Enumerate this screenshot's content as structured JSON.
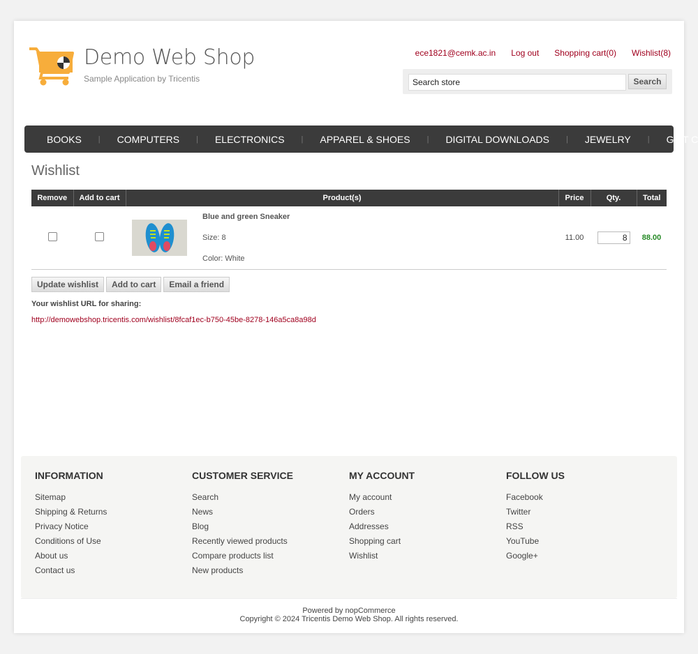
{
  "logo": {
    "title": "Demo Web Shop",
    "subtitle": "Sample Application by Tricentis"
  },
  "header_links": [
    "ece1821@cemk.ac.in",
    "Log out",
    "Shopping cart(0)",
    "Wishlist(8)"
  ],
  "search": {
    "value": "Search store",
    "button": "Search"
  },
  "menu": [
    "BOOKS",
    "COMPUTERS",
    "ELECTRONICS",
    "APPAREL & SHOES",
    "DIGITAL DOWNLOADS",
    "JEWELRY",
    "GIFT CARDS"
  ],
  "page_title": "Wishlist",
  "table": {
    "headers": [
      "Remove",
      "Add to cart",
      "Product(s)",
      "Price",
      "Qty.",
      "Total"
    ],
    "rows": [
      {
        "name": "Blue and green Sneaker",
        "size": "Size: 8",
        "color": "Color: White",
        "price": "11.00",
        "qty": "8",
        "total": "88.00"
      }
    ]
  },
  "buttons": [
    "Update wishlist",
    "Add to cart",
    "Email a friend"
  ],
  "share": {
    "label": "Your wishlist URL for sharing:",
    "url": "http://demowebshop.tricentis.com/wishlist/8fcaf1ec-b750-45be-8278-146a5ca8a98d"
  },
  "footer": {
    "columns": [
      {
        "title": "INFORMATION",
        "items": [
          "Sitemap",
          "Shipping & Returns",
          "Privacy Notice",
          "Conditions of Use",
          "About us",
          "Contact us"
        ]
      },
      {
        "title": "CUSTOMER SERVICE",
        "items": [
          "Search",
          "News",
          "Blog",
          "Recently viewed products",
          "Compare products list",
          "New products"
        ]
      },
      {
        "title": "MY ACCOUNT",
        "items": [
          "My account",
          "Orders",
          "Addresses",
          "Shopping cart",
          "Wishlist"
        ]
      },
      {
        "title": "FOLLOW US",
        "items": [
          "Facebook",
          "Twitter",
          "RSS",
          "YouTube",
          "Google+"
        ]
      }
    ],
    "powered": "Powered by nopCommerce",
    "copyright": "Copyright © 2024 Tricentis Demo Web Shop. All rights reserved."
  },
  "colors": {
    "accent": "#a0001e",
    "menu_bg": "#3b3b3b",
    "total_green": "#268a26",
    "logo_orange": "#f7ad3b"
  },
  "icons": [
    "shopping-cart-logo-icon"
  ]
}
